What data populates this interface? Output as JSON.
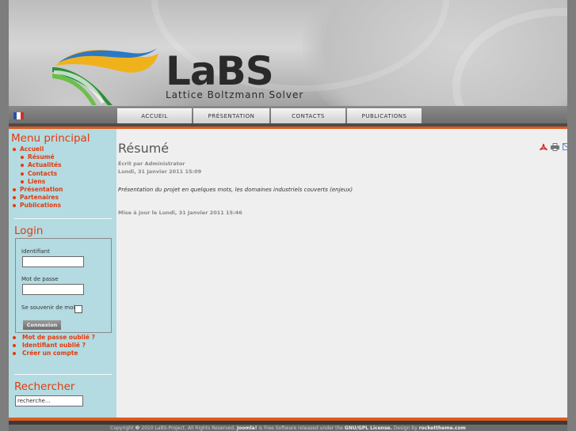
{
  "logo": {
    "name": "LaBS",
    "subtitle": "Lattice Boltzmann Solver"
  },
  "colors": {
    "accent": "#e23a0f",
    "sidebar_bg": "#b3dbe1",
    "band_orange": "#e05a1c"
  },
  "nav": {
    "tabs": [
      {
        "label": "ACCUEIL"
      },
      {
        "label": "PRÉSENTATION"
      },
      {
        "label": "CONTACTS"
      },
      {
        "label": "PUBLICATIONS"
      }
    ]
  },
  "sidebar": {
    "menu_title": "Menu principal",
    "menu_items": [
      {
        "label": "Accueil"
      },
      {
        "label": "Résumé"
      },
      {
        "label": "Actualités"
      },
      {
        "label": "Contacts"
      },
      {
        "label": "Liens"
      },
      {
        "label": "Présentation"
      },
      {
        "label": "Partenaires"
      },
      {
        "label": "Publications"
      }
    ],
    "login": {
      "title": "Login",
      "username_label": "Identifiant",
      "password_label": "Mot de passe",
      "remember_label": "Se souvenir de moi",
      "submit_label": "Connexion",
      "links": [
        {
          "label": "Mot de passe oublié ?"
        },
        {
          "label": "Identifiant oublié ?"
        },
        {
          "label": "Créer un compte"
        }
      ]
    },
    "search": {
      "title": "Rechercher",
      "value": "recherche..."
    }
  },
  "article": {
    "title": "Résumé",
    "author": "Écrit par Administrator",
    "date": "Lundi, 31 Janvier 2011 15:09",
    "intro": "Présentation du projet en quelques mots, les domaines industriels couverts (enjeux)",
    "updated": "Mise à jour le Lundi, 31 Janvier 2011 15:46"
  },
  "footer": {
    "copyright": "Copyright � 2010 LaBS-Project. All Rights Reserved.",
    "joomla": "Joomla!",
    "free_text": "is Free Software released under the",
    "license": "GNU/GPL License.",
    "design_text": "Design by",
    "designer": "rockettheme.com"
  }
}
